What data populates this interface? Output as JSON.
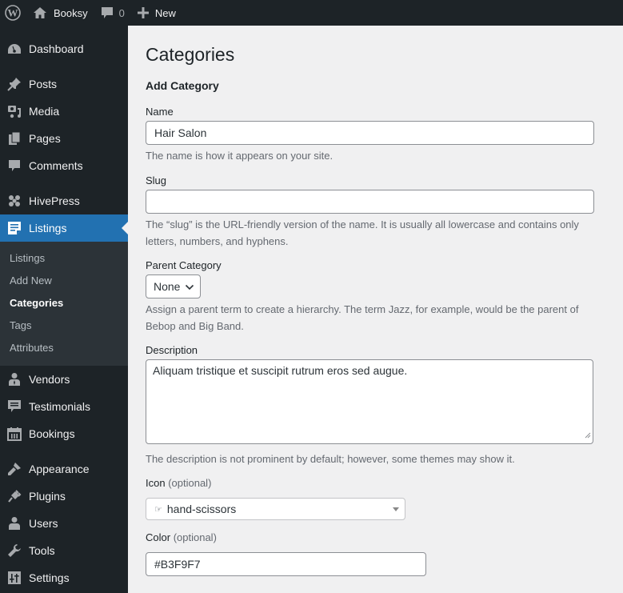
{
  "admin_bar": {
    "wp_logo_icon": "wordpress-logo-icon",
    "site_name": "Booksy",
    "site_icon": "home-icon",
    "comments_icon": "comment-bubble-icon",
    "comments_count": "0",
    "new_icon": "plus-icon",
    "new_label": "New"
  },
  "sidebar": {
    "items": [
      {
        "label": "Dashboard",
        "icon": "dashboard-gauge-icon"
      },
      {
        "label": "Posts",
        "icon": "pushpin-icon"
      },
      {
        "label": "Media",
        "icon": "media-icon"
      },
      {
        "label": "Pages",
        "icon": "pages-icon"
      },
      {
        "label": "Comments",
        "icon": "comment-icon"
      },
      {
        "label": "HivePress",
        "icon": "hivepress-icon"
      },
      {
        "label": "Listings",
        "icon": "listing-document-icon",
        "current": true
      },
      {
        "label": "Vendors",
        "icon": "vendor-user-icon"
      },
      {
        "label": "Testimonials",
        "icon": "testimonial-icon"
      },
      {
        "label": "Bookings",
        "icon": "calendar-icon"
      },
      {
        "label": "Appearance",
        "icon": "paintbrush-icon"
      },
      {
        "label": "Plugins",
        "icon": "plug-icon"
      },
      {
        "label": "Users",
        "icon": "users-icon"
      },
      {
        "label": "Tools",
        "icon": "wrench-icon"
      },
      {
        "label": "Settings",
        "icon": "settings-sliders-icon"
      }
    ],
    "submenu": [
      {
        "label": "Listings"
      },
      {
        "label": "Add New"
      },
      {
        "label": "Categories",
        "current": true
      },
      {
        "label": "Tags"
      },
      {
        "label": "Attributes"
      }
    ]
  },
  "main": {
    "page_title": "Categories",
    "section_title": "Add Category",
    "name": {
      "label": "Name",
      "value": "Hair Salon",
      "description": "The name is how it appears on your site."
    },
    "slug": {
      "label": "Slug",
      "value": "",
      "description": "The “slug” is the URL-friendly version of the name. It is usually all lowercase and contains only letters, numbers, and hyphens."
    },
    "parent": {
      "label": "Parent Category",
      "selected": "None",
      "description": "Assign a parent term to create a hierarchy. The term Jazz, for example, would be the parent of Bebop and Big Band."
    },
    "description": {
      "label": "Description",
      "value": "Aliquam tristique et suscipit rutrum eros sed augue.",
      "description": "The description is not prominent by default; however, some themes may show it."
    },
    "icon": {
      "label": "Icon",
      "optional": "(optional)",
      "selected": "hand-scissors",
      "glyph": "☞"
    },
    "color": {
      "label": "Color",
      "optional": "(optional)",
      "value": "#B3F9F7"
    }
  },
  "colors": {
    "admin_bar_bg": "#1d2327",
    "sidebar_bg": "#1d2327",
    "submenu_bg": "#2c3338",
    "accent": "#2271b1",
    "page_bg": "#f0f0f1"
  }
}
